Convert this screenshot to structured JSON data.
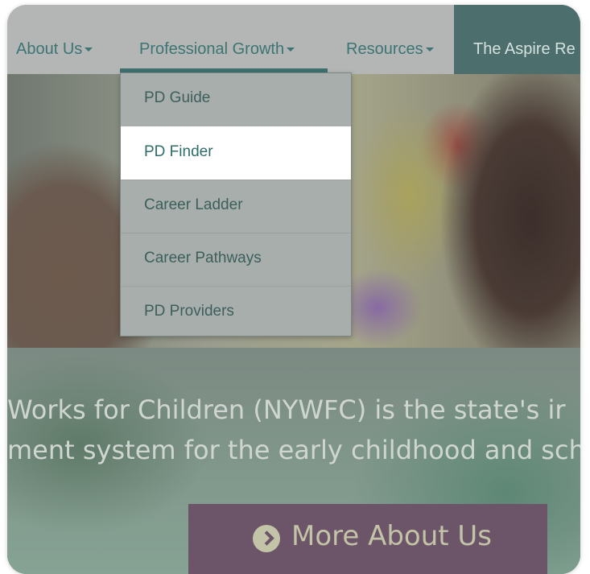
{
  "nav": {
    "items": [
      {
        "label": "About Us"
      },
      {
        "label": "Professional Growth"
      },
      {
        "label": "Resources"
      }
    ],
    "aspire_label": "The Aspire Re"
  },
  "dropdown": {
    "items": [
      {
        "label": "PD Guide"
      },
      {
        "label": "PD Finder"
      },
      {
        "label": "Career Ladder"
      },
      {
        "label": "Career Pathways"
      },
      {
        "label": "PD Providers"
      }
    ],
    "active_index": 1
  },
  "hero": {
    "text_line1": "Works for Children (NYWFC) is the state's ir",
    "text_line2": "ment system for the early childhood and sch",
    "cta_label": "More About Us"
  },
  "colors": {
    "accent": "#3d7474",
    "aspire_bg": "#4c6e6c",
    "cta_bg": "#6c5568",
    "cta_text": "#c3c3a7"
  },
  "icons": {
    "cta_icon": "chevron-right-circle-icon",
    "caret": "caret-down-icon"
  }
}
